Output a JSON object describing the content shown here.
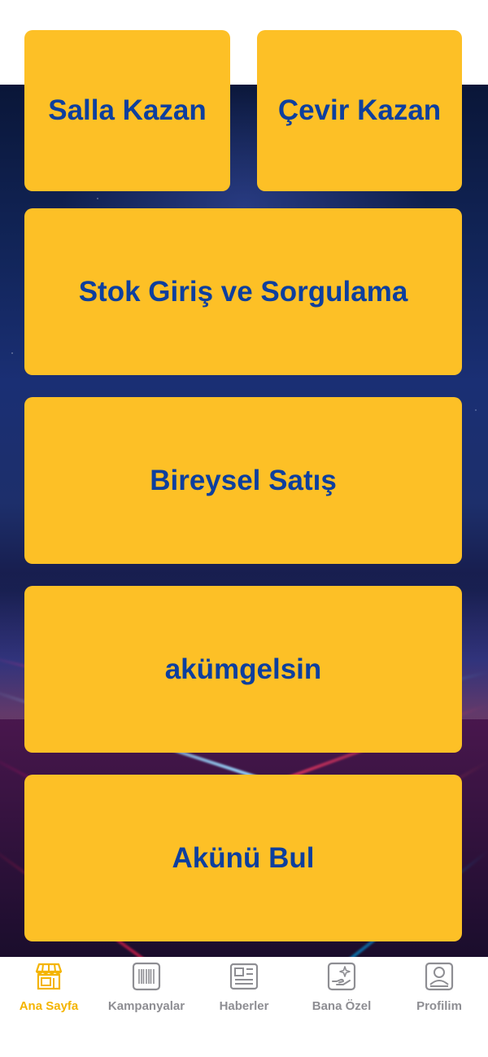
{
  "colors": {
    "tile_background": "#fdc026",
    "tile_text": "#0d3f9e",
    "tab_active": "#f4b400",
    "tab_inactive": "#8e8e93"
  },
  "tiles": {
    "salla_kazan": "Salla Kazan",
    "cevir_kazan": "Çevir Kazan",
    "stok_giris": "Stok Giriş ve Sorgulama",
    "bireysel_satis": "Bireysel Satış",
    "akumgelsin": "akümgelsin",
    "akunu_bul": "Akünü Bul"
  },
  "tabbar": {
    "active": "ana_sayfa",
    "items": [
      {
        "id": "ana_sayfa",
        "label": "Ana Sayfa",
        "icon": "store-icon"
      },
      {
        "id": "kampanyalar",
        "label": "Kampanyalar",
        "icon": "barcode-icon"
      },
      {
        "id": "haberler",
        "label": "Haberler",
        "icon": "newspaper-icon"
      },
      {
        "id": "bana_ozel",
        "label": "Bana Özel",
        "icon": "hand-sparkle-icon"
      },
      {
        "id": "profilim",
        "label": "Profilim",
        "icon": "profile-icon"
      }
    ]
  }
}
